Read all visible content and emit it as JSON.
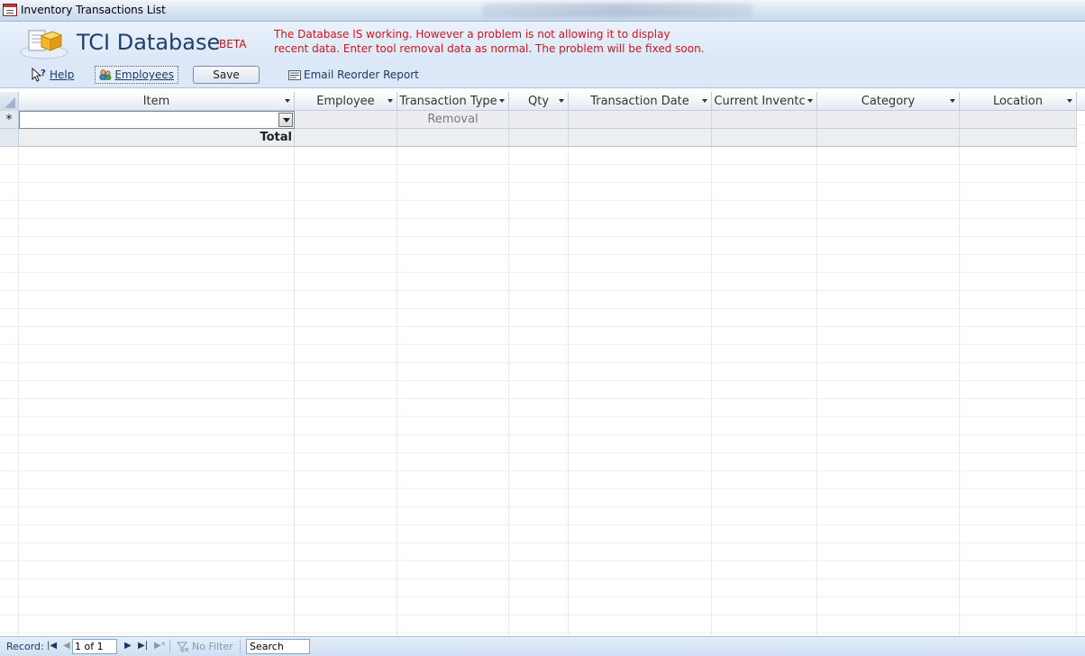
{
  "window": {
    "title": "Inventory Transactions List"
  },
  "header": {
    "app_title": "TCI Database",
    "beta_label": "BETA",
    "notice": "The Database IS working. However a problem is not allowing it to display recent data. Enter tool removal data as normal. The problem will be fixed soon."
  },
  "toolbar": {
    "help_label": "Help",
    "employees_label": "Employees",
    "save_label": "Save",
    "email_label": "Email Reorder Report"
  },
  "grid": {
    "columns": [
      {
        "label": "Item"
      },
      {
        "label": "Employee"
      },
      {
        "label": "Transaction Type"
      },
      {
        "label": "Qty"
      },
      {
        "label": "Transaction Date"
      },
      {
        "label": "Current Inventc"
      },
      {
        "label": "Category"
      },
      {
        "label": "Location"
      }
    ],
    "new_row": {
      "selector": "*",
      "item": "",
      "employee": "",
      "transaction_type": "Removal",
      "qty": "",
      "transaction_date": "",
      "current_inventory": "",
      "category": "",
      "location": ""
    },
    "total_label": "Total"
  },
  "statusbar": {
    "record_label": "Record:",
    "record_position": "1 of 1",
    "filter_label": "No Filter",
    "search_label": "Search"
  },
  "colors": {
    "notice_red": "#d0141a",
    "title_blue": "#1f3f71",
    "toolbar_bg": "#dce8f7"
  }
}
